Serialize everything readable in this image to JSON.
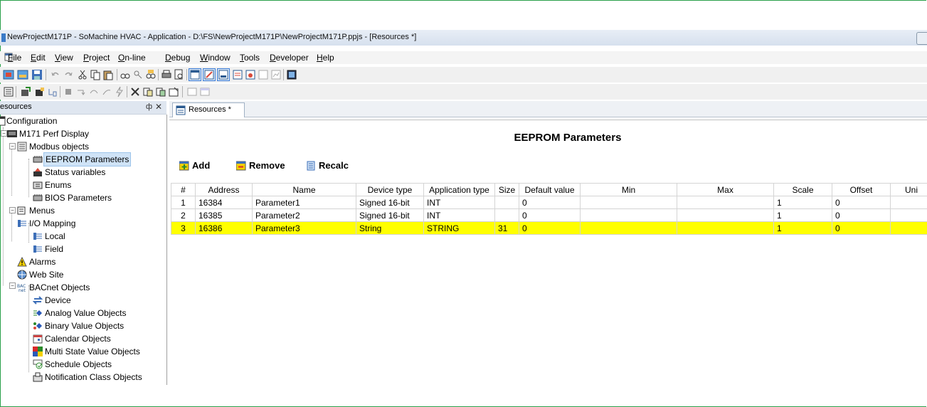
{
  "window": {
    "title": "NewProjectM171P - SoMachine HVAC - Application - D:\\FS\\NewProjectM171P\\NewProjectM171P.ppjs - [Resources *]"
  },
  "menu": [
    {
      "pre": "",
      "u": "F",
      "post": "ile"
    },
    {
      "pre": "",
      "u": "E",
      "post": "dit"
    },
    {
      "pre": "",
      "u": "V",
      "post": "iew"
    },
    {
      "pre": "",
      "u": "P",
      "post": "roject"
    },
    {
      "pre": "",
      "u": "O",
      "post": "n-line"
    },
    {
      "pre": "",
      "u": "D",
      "post": "ebug"
    },
    {
      "pre": "",
      "u": "W",
      "post": "indow"
    },
    {
      "pre": "",
      "u": "T",
      "post": "ools"
    },
    {
      "pre": "",
      "u": "D",
      "post": "eveloper"
    },
    {
      "pre": "",
      "u": "H",
      "post": "elp"
    }
  ],
  "panel": {
    "title": "esources",
    "pin": "ф",
    "close": "✕"
  },
  "tree": [
    {
      "label": "Configuration",
      "icon": "configuration-icon"
    },
    {
      "label": "M171 Perf Display",
      "icon": "device-display-icon"
    },
    {
      "label": "Modbus objects",
      "icon": "modbus-objects-icon"
    },
    {
      "label": "EEPROM Parameters",
      "icon": "eeprom-icon"
    },
    {
      "label": "Status variables",
      "icon": "status-variables-icon"
    },
    {
      "label": "Enums",
      "icon": "enums-icon"
    },
    {
      "label": "BIOS Parameters",
      "icon": "bios-icon"
    },
    {
      "label": "Menus",
      "icon": "menus-icon"
    },
    {
      "label": "I/O Mapping",
      "icon": "io-mapping-icon"
    },
    {
      "label": "Local",
      "icon": "io-local-icon"
    },
    {
      "label": "Field",
      "icon": "io-field-icon"
    },
    {
      "label": "Alarms",
      "icon": "alarm-icon"
    },
    {
      "label": "Web Site",
      "icon": "web-site-icon"
    },
    {
      "label": "BACnet Objects",
      "icon": "bacnet-icon"
    },
    {
      "label": "Device",
      "icon": "bacnet-device-icon"
    },
    {
      "label": "Analog Value Objects",
      "icon": "analog-value-icon"
    },
    {
      "label": "Binary Value Objects",
      "icon": "binary-value-icon"
    },
    {
      "label": "Calendar Objects",
      "icon": "calendar-icon"
    },
    {
      "label": "Multi State Value Objects",
      "icon": "multi-state-icon"
    },
    {
      "label": "Schedule Objects",
      "icon": "schedule-icon"
    },
    {
      "label": "Notification Class Objects",
      "icon": "notification-class-icon"
    }
  ],
  "tab": {
    "label": "Resources *"
  },
  "content": {
    "title": "EEPROM Parameters",
    "actions": {
      "add": "Add",
      "remove": "Remove",
      "recalc": "Recalc"
    }
  },
  "table": {
    "headers": [
      "#",
      "Address",
      "Name",
      "Device type",
      "Application type",
      "Size",
      "Default value",
      "Min",
      "Max",
      "Scale",
      "Offset",
      "Uni"
    ],
    "rows": [
      [
        "1",
        "16384",
        "Parameter1",
        "Signed 16-bit",
        "INT",
        "",
        "0",
        "",
        "",
        "1",
        "0",
        ""
      ],
      [
        "2",
        "16385",
        "Parameter2",
        "Signed 16-bit",
        "INT",
        "",
        "0",
        "",
        "",
        "1",
        "0",
        ""
      ],
      [
        "3",
        "16386",
        "Parameter3",
        "String",
        "STRING",
        "31",
        "0",
        "",
        "",
        "1",
        "0",
        ""
      ]
    ],
    "highlight_row": 3,
    "highlight_color": "#ffff00"
  },
  "colors": {
    "accent_border": "#2aa04a",
    "selection": "#cfe3f7"
  }
}
